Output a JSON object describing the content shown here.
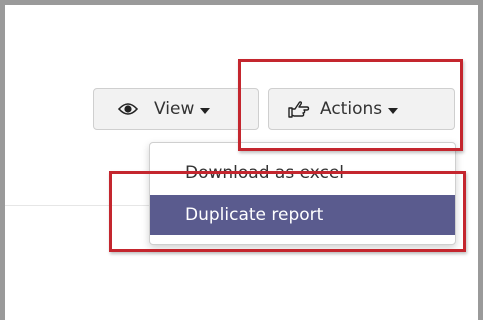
{
  "toolbar": {
    "view_label": "View",
    "actions_label": "Actions"
  },
  "actions_menu": {
    "items": [
      {
        "label": "Download as excel"
      },
      {
        "label": "Duplicate report",
        "highlighted": true
      }
    ]
  },
  "icons": {
    "view": "eye-icon",
    "actions": "pointing-hand-icon",
    "dropdown": "caret-down-icon"
  },
  "colors": {
    "highlight_box": "#c4262e",
    "selected_item_bg": "#5a5b8e",
    "selected_item_text": "#ffffff",
    "button_bg": "#f2f2f2"
  }
}
